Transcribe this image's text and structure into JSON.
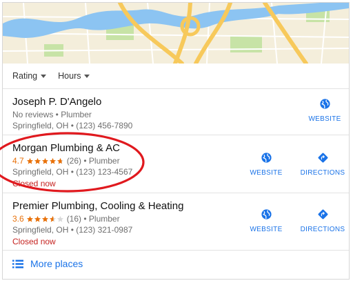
{
  "filters": [
    {
      "label": "Rating"
    },
    {
      "label": "Hours"
    }
  ],
  "listings": [
    {
      "name": "Joseph P. D'Angelo",
      "review_line": "No reviews • Plumber",
      "address_line": "Springfield, OH • (123) 456-7890",
      "actions": [
        {
          "label": "WEBSITE",
          "icon": "globe-icon"
        }
      ]
    },
    {
      "name": "Morgan Plumbing & AC",
      "rating": "4.7",
      "rating_value": 4.7,
      "reviews_text": "(26) • Plumber",
      "address_line": "Springfield, OH • (123) 123-4567",
      "status": "Closed now",
      "actions": [
        {
          "label": "WEBSITE",
          "icon": "globe-icon"
        },
        {
          "label": "DIRECTIONS",
          "icon": "directions-icon"
        }
      ]
    },
    {
      "name": "Premier Plumbing, Cooling & Heating",
      "rating": "3.6",
      "rating_value": 3.6,
      "reviews_text": "(16) • Plumber",
      "address_line": "Springfield, OH • (123) 321-0987",
      "status": "Closed now",
      "actions": [
        {
          "label": "WEBSITE",
          "icon": "globe-icon"
        },
        {
          "label": "DIRECTIONS",
          "icon": "directions-icon"
        }
      ]
    }
  ],
  "more_places": {
    "label": "More places",
    "icon": "list-icon"
  },
  "colors": {
    "accent_blue": "#1a73e8",
    "star_orange": "#e8710a",
    "closed_red": "#c5221f",
    "highlight_oval": "#e0191e"
  }
}
